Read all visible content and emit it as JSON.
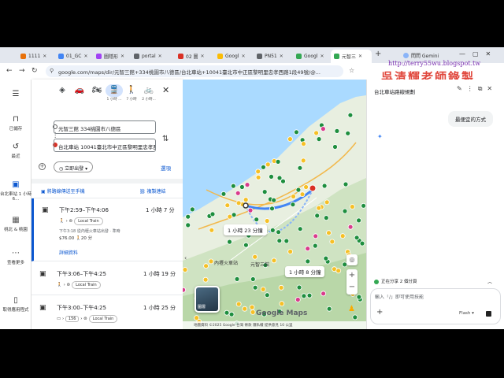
{
  "browser": {
    "tabs": [
      {
        "label": "1111",
        "color": "#e8710a"
      },
      {
        "label": "01_GC",
        "color": "#4285f4"
      },
      {
        "label": "圖隱形",
        "color": "#a142f4"
      },
      {
        "label": "portal",
        "color": "#5f6368"
      },
      {
        "label": "02 圖",
        "color": "#d93025"
      },
      {
        "label": "Googl",
        "color": "#fbbc04"
      },
      {
        "label": "PN51",
        "color": "#5f6368"
      },
      {
        "label": "Googl",
        "color": "#34a853"
      },
      {
        "label": "元智三",
        "color": "#34a853",
        "active": true
      }
    ],
    "new_tab": "+",
    "profile_label": "問問 Gemini",
    "url": "google.com/maps/dir/元智三館+334桃園市八德區/台北車站+10041臺北市中正區黎明里忠孝西路1段49號/@..."
  },
  "overlay": {
    "url": "http://terry55wu.blogspot.tw",
    "signature": "吳清輝老師錄製"
  },
  "rail": {
    "menu_icon": "menu-icon",
    "saved": "已儲存",
    "recent": "最近",
    "recent_place": "台北車站 1 小時 6...",
    "taoyuan": "桃北 & 桃園",
    "more": "查看更多",
    "get_app": "取得應用程式"
  },
  "directions": {
    "modes": [
      {
        "icon": "route-icon",
        "glyph": "◈",
        "time": ""
      },
      {
        "icon": "car-icon",
        "glyph": "🚗",
        "time": ""
      },
      {
        "icon": "motorcycle-icon",
        "glyph": "🏍",
        "time": ""
      },
      {
        "icon": "transit-icon",
        "glyph": "🚆",
        "time": "1 小時 ...",
        "active": true
      },
      {
        "icon": "walk-icon",
        "glyph": "🚶",
        "time": "7 小時"
      },
      {
        "icon": "bike-icon",
        "glyph": "🚲",
        "time": "2 小時..."
      }
    ],
    "origin": "元智三館 334桃園市八德區",
    "destination": "台北車站 10041臺北市中正區黎明里忠孝西",
    "depart": "立即出發",
    "options": "選項",
    "send_to_phone": "將路線傳送至手機",
    "copy_link": "複製連結",
    "routes": [
      {
        "time": "下午2:59–下午4:06",
        "duration": "1 小時 7 分",
        "train": "Local Train",
        "meta": "下午3:18 從內壢火車站出發 · 準時",
        "ontime": "準時",
        "fare": "$76.00",
        "walk": "20 分",
        "details": "詳細資料",
        "selected": true
      },
      {
        "time": "下午3:06–下午4:25",
        "duration": "1 小時 19 分",
        "train": "Local Train"
      },
      {
        "time": "下午3:00–下午4:25",
        "duration": "1 小時 25 分",
        "bus": "156",
        "train": "Local Train"
      }
    ]
  },
  "map": {
    "chips": [
      "1 小時 23 分鐘",
      "1 小時 8 分鐘"
    ],
    "places": [
      "內壢火車站",
      "元智三館"
    ],
    "layers": "圖層",
    "logo": "Google Maps",
    "attribution": "地圖資料 ©2025 Google   台灣   條款   隱私權   提供意見   10 公里"
  },
  "gemini": {
    "title": "台北車站路線規劃",
    "user_message": "最便宜的方式",
    "share_status": "正在分享 2 個分頁",
    "input_placeholder": "輸入「/」即可使用技能",
    "model": "Flash"
  }
}
